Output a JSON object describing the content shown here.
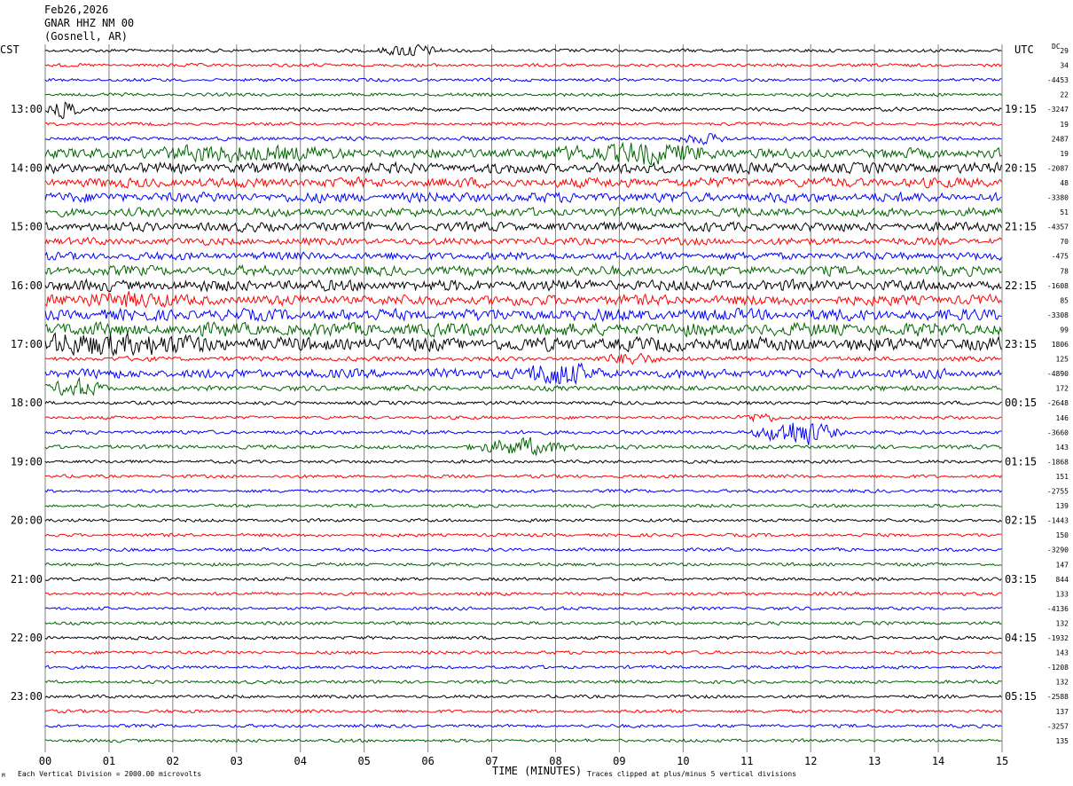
{
  "header": {
    "date": "Feb26,2026",
    "station": "GNAR HHZ NM 00",
    "location": "(Gosnell, AR)"
  },
  "left_tz": "CST",
  "right_tz": "UTC",
  "dc_label": "DC",
  "footer": {
    "scale_note": "Each Vertical Division = 2000.00 microvolts",
    "clip_note": "Traces clipped at plus/minus 5 vertical divisions",
    "corner_mark": "M"
  },
  "colors": {
    "black": "#000000",
    "red": "#ff0000",
    "blue": "#0000ff",
    "green": "#006400",
    "grid": "#808080"
  },
  "chart_data": {
    "type": "line",
    "title": "GNAR HHZ NM 00",
    "xlabel": "TIME (MINUTES)",
    "ylabel": "",
    "x_ticks": [
      "00",
      "01",
      "02",
      "03",
      "04",
      "05",
      "06",
      "07",
      "08",
      "09",
      "10",
      "11",
      "12",
      "13",
      "14",
      "15"
    ],
    "xlim": [
      0,
      15
    ],
    "minutes_per_line": 15,
    "line_colors": [
      "black",
      "red",
      "blue",
      "green"
    ],
    "left_hour_labels": [
      "13:00",
      "14:00",
      "15:00",
      "16:00",
      "17:00",
      "18:00",
      "19:00",
      "20:00",
      "21:00",
      "22:00",
      "23:00"
    ],
    "right_hour_labels": [
      "19:15",
      "20:15",
      "21:15",
      "22:15",
      "23:15",
      "00:15",
      "01:15",
      "02:15",
      "03:15",
      "04:15",
      "05:15"
    ],
    "dc_offsets": [
      "29",
      "34",
      "-4453",
      "22",
      "-3247",
      "19",
      "2487",
      "19",
      "-2087",
      "48",
      "-3380",
      "51",
      "-4357",
      "70",
      "-475",
      "78",
      "-1608",
      "85",
      "-3308",
      "99",
      "1806",
      "125",
      "-4890",
      "172",
      "-2648",
      "146",
      "-3660",
      "143",
      "-1868",
      "151",
      "-2755",
      "139",
      "-1443",
      "150",
      "-3290",
      "147",
      "844",
      "133",
      "-4136",
      "132",
      "-1932",
      "143",
      "-1208",
      "132",
      "-2588",
      "137",
      "-3257",
      "135"
    ],
    "amplitude_levels": [
      1.0,
      1.0,
      1.0,
      1.0,
      1.2,
      1.0,
      1.2,
      3.0,
      3.2,
      3.0,
      3.0,
      2.6,
      2.8,
      2.2,
      2.4,
      3.0,
      3.4,
      3.2,
      3.6,
      4.0,
      4.2,
      1.4,
      2.8,
      1.6,
      1.1,
      1.0,
      1.2,
      1.2,
      1.0,
      1.0,
      1.0,
      1.0,
      1.0,
      1.0,
      1.0,
      1.0,
      1.0,
      1.0,
      1.0,
      1.0,
      1.0,
      1.0,
      1.0,
      1.0,
      1.0,
      1.0,
      1.0,
      1.0
    ],
    "events": [
      {
        "line": 0,
        "minute": 5.7,
        "amplitude": 4.0,
        "width": 0.6
      },
      {
        "line": 4,
        "minute": 0.3,
        "amplitude": 5.0,
        "width": 0.3
      },
      {
        "line": 6,
        "minute": 10.3,
        "amplitude": 2.5,
        "width": 0.5
      },
      {
        "line": 7,
        "minute": 3.0,
        "amplitude": 3.0,
        "width": 2.0
      },
      {
        "line": 7,
        "minute": 9.3,
        "amplitude": 4.5,
        "width": 1.6
      },
      {
        "line": 17,
        "minute": 1.2,
        "amplitude": 3.0,
        "width": 1.0
      },
      {
        "line": 20,
        "minute": 1.0,
        "amplitude": 4.0,
        "width": 2.0
      },
      {
        "line": 21,
        "minute": 9.2,
        "amplitude": 3.0,
        "width": 0.6
      },
      {
        "line": 22,
        "minute": 8.0,
        "amplitude": 6.0,
        "width": 0.8
      },
      {
        "line": 23,
        "minute": 0.5,
        "amplitude": 4.5,
        "width": 0.6
      },
      {
        "line": 25,
        "minute": 11.2,
        "amplitude": 3.0,
        "width": 0.4
      },
      {
        "line": 26,
        "minute": 11.8,
        "amplitude": 8.0,
        "width": 0.8
      },
      {
        "line": 27,
        "minute": 7.5,
        "amplitude": 5.0,
        "width": 1.0
      }
    ]
  }
}
